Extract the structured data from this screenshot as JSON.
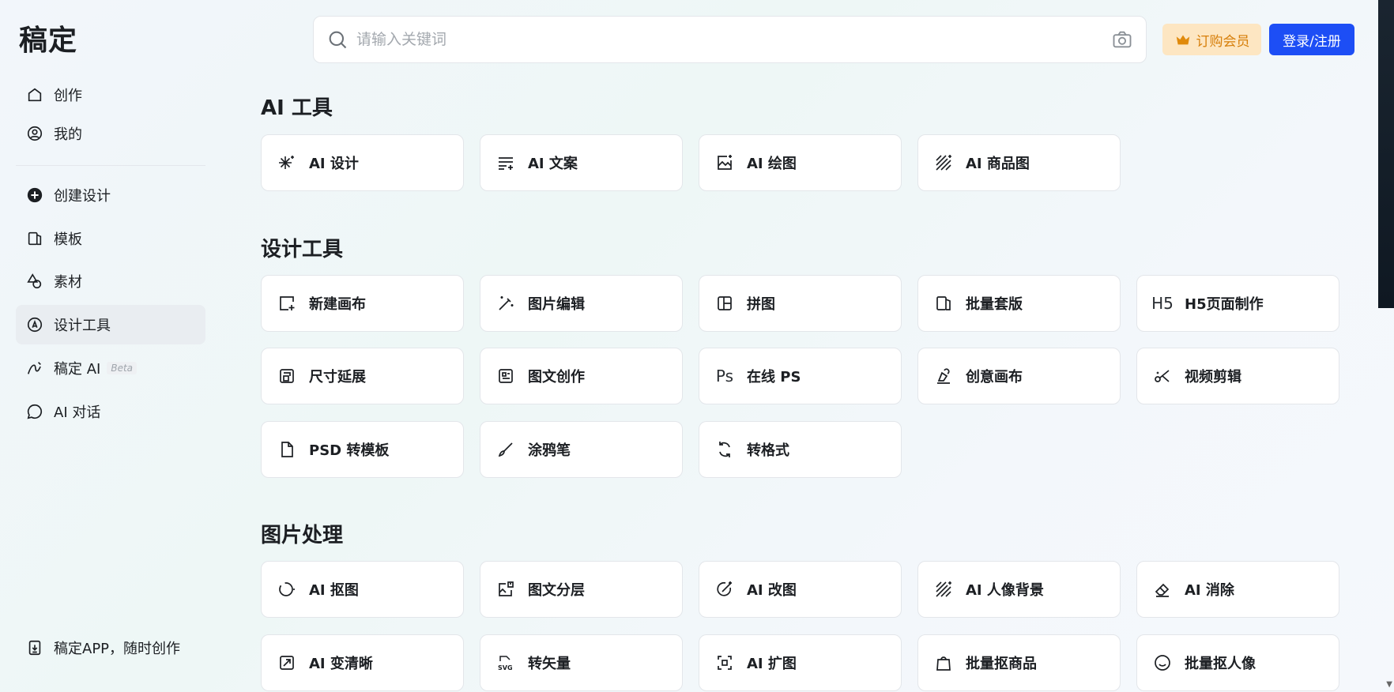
{
  "app": {
    "logo": "稿定"
  },
  "sidebar": {
    "items": [
      {
        "label": "创作",
        "icon": "home-icon"
      },
      {
        "label": "我的",
        "icon": "user-icon"
      },
      {
        "label": "创建设计",
        "icon": "plus-circle-icon"
      },
      {
        "label": "模板",
        "icon": "template-icon"
      },
      {
        "label": "素材",
        "icon": "shapes-icon"
      },
      {
        "label": "设计工具",
        "icon": "design-tool-icon",
        "active": true
      },
      {
        "label": "稿定 AI",
        "icon": "ai-pen-icon",
        "badge": "Beta"
      },
      {
        "label": "AI 对话",
        "icon": "chat-icon"
      }
    ],
    "bottom": {
      "label": "稿定APP，随时创作",
      "icon": "download-app-icon"
    }
  },
  "header": {
    "search_placeholder": "请输入关键词",
    "vip_label": "订购会员",
    "login_label": "登录/注册",
    "accent": "#1d4ef5",
    "vip_color": "#d77f0a"
  },
  "sections": [
    {
      "title": "AI 工具",
      "cards": [
        {
          "label": "AI 设计",
          "icon": "sparkle-icon"
        },
        {
          "label": "AI 文案",
          "icon": "text-lines-icon"
        },
        {
          "label": "AI 绘图",
          "icon": "image-sparkle-icon"
        },
        {
          "label": "AI 商品图",
          "icon": "hatch-icon"
        }
      ]
    },
    {
      "title": "设计工具",
      "cards": [
        {
          "label": "新建画布",
          "icon": "new-canvas-icon"
        },
        {
          "label": "图片编辑",
          "icon": "magic-wand-icon"
        },
        {
          "label": "拼图",
          "icon": "collage-icon"
        },
        {
          "label": "批量套版",
          "icon": "batch-template-icon"
        },
        {
          "label": "H5页面制作",
          "icon_text": "H5"
        },
        {
          "label": "尺寸延展",
          "icon": "resize-icon"
        },
        {
          "label": "图文创作",
          "icon": "article-icon"
        },
        {
          "label": "在线 PS",
          "icon_text": "Ps"
        },
        {
          "label": "创意画布",
          "icon": "creative-canvas-icon"
        },
        {
          "label": "视频剪辑",
          "icon": "scissors-icon"
        },
        {
          "label": "PSD 转模板",
          "icon": "file-icon"
        },
        {
          "label": "涂鸦笔",
          "icon": "brush-icon"
        },
        {
          "label": "转格式",
          "icon": "convert-icon"
        }
      ]
    },
    {
      "title": "图片处理",
      "cards": [
        {
          "label": "AI 抠图",
          "icon": "cutout-icon"
        },
        {
          "label": "图文分层",
          "icon": "layer-icon"
        },
        {
          "label": "AI 改图",
          "icon": "edit-image-icon"
        },
        {
          "label": "AI 人像背景",
          "icon": "portrait-bg-icon"
        },
        {
          "label": "AI 消除",
          "icon": "eraser-icon"
        },
        {
          "label": "AI 变清晰",
          "icon": "sharpen-icon"
        },
        {
          "label": "转矢量",
          "icon": "svg-icon"
        },
        {
          "label": "AI 扩图",
          "icon": "expand-icon"
        },
        {
          "label": "批量抠商品",
          "icon": "bag-icon"
        },
        {
          "label": "批量抠人像",
          "icon": "face-icon"
        }
      ]
    }
  ]
}
